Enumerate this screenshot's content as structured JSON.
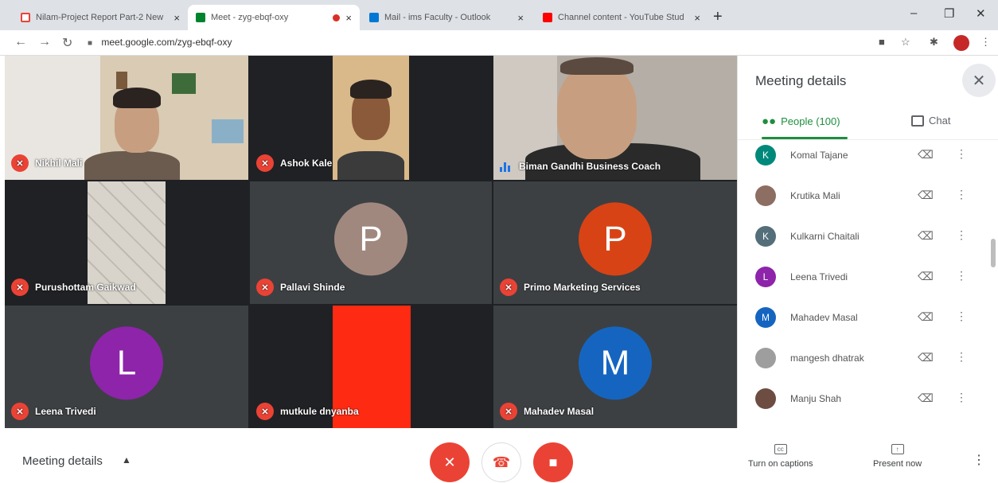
{
  "browser": {
    "tabs": [
      {
        "label": "Nilam-Project Report Part-2 New",
        "icon": "gmail-icon",
        "color": "#ea4335"
      },
      {
        "label": "Meet - zyg-ebqf-oxy",
        "icon": "meet-icon",
        "color": "#00832d"
      },
      {
        "label": "Mail - ims Faculty - Outlook",
        "icon": "outlook-icon",
        "color": "#0078d4"
      },
      {
        "label": "Channel content - YouTube Stud",
        "icon": "youtube-icon",
        "color": "#ff0000"
      }
    ],
    "url": "meet.google.com/zyg-ebqf-oxy",
    "close_glyph": "×",
    "newtab_glyph": "+"
  },
  "meet": {
    "tiles": [
      {
        "name": "Nikhil Mali",
        "muted": true,
        "type": "video"
      },
      {
        "name": "Ashok Kale",
        "muted": true,
        "type": "video"
      },
      {
        "name": "Biman Gandhi Business Coach",
        "muted": false,
        "type": "video"
      },
      {
        "name": "Purushottam Gaikwad",
        "muted": true,
        "type": "video"
      },
      {
        "name": "Pallavi Shinde",
        "muted": true,
        "type": "avatar",
        "initial": "P",
        "color": "#a1887f"
      },
      {
        "name": "Primo Marketing Services",
        "muted": true,
        "type": "avatar",
        "initial": "P",
        "color": "#d84315"
      },
      {
        "name": "Leena Trivedi",
        "muted": true,
        "type": "avatar",
        "initial": "L",
        "color": "#8e24aa"
      },
      {
        "name": "mutkule dnyanba",
        "muted": true,
        "type": "video"
      },
      {
        "name": "Mahadev Masal",
        "muted": true,
        "type": "avatar",
        "initial": "M",
        "color": "#1565c0"
      }
    ]
  },
  "panel": {
    "title": "Meeting details",
    "tab_people": "People (100)",
    "tab_chat": "Chat",
    "people": [
      {
        "name": "Komal Tajane",
        "initial": "K",
        "color": "#00897b"
      },
      {
        "name": "Krutika Mali",
        "initial": "",
        "color": "#8d6e63"
      },
      {
        "name": "Kulkarni Chaitali",
        "initial": "K",
        "color": "#546e7a"
      },
      {
        "name": "Leena Trivedi",
        "initial": "L",
        "color": "#8e24aa"
      },
      {
        "name": "Mahadev Masal",
        "initial": "M",
        "color": "#1565c0"
      },
      {
        "name": "mangesh dhatrak",
        "initial": "",
        "color": "#9e9e9e"
      },
      {
        "name": "Manju Shah",
        "initial": "",
        "color": "#6d4c41"
      }
    ]
  },
  "bottom": {
    "meeting_details": "Meeting details",
    "captions": "Turn on captions",
    "present": "Present now"
  }
}
